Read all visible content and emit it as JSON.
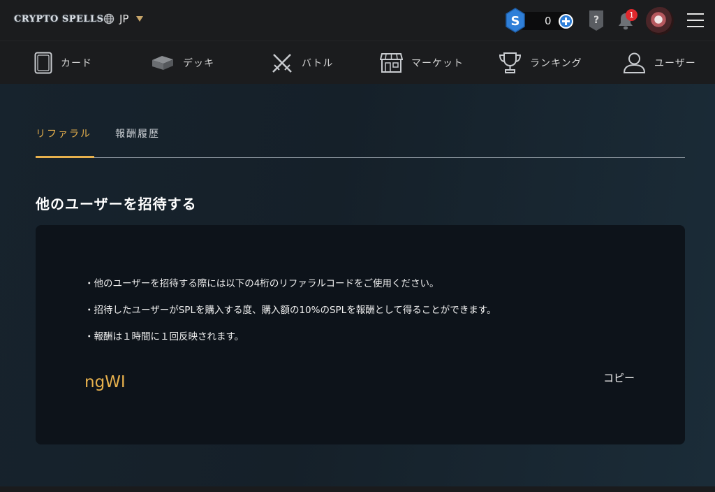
{
  "header": {
    "logo_text": "CRYPTO SPELLS",
    "language": "JP",
    "wallet_balance": "0",
    "notification_count": "1",
    "icons": [
      "globe-icon",
      "caret-down-icon",
      "spl-coin-icon",
      "add-funds-icon",
      "help-icon",
      "bell-icon",
      "avatar",
      "hamburger-menu-icon"
    ]
  },
  "nav": {
    "items": [
      {
        "label": "カード",
        "icon": "card-icon"
      },
      {
        "label": "デッキ",
        "icon": "deck-icon"
      },
      {
        "label": "バトル",
        "icon": "crossed-swords-icon"
      },
      {
        "label": "マーケット",
        "icon": "storefront-icon"
      },
      {
        "label": "ランキング",
        "icon": "trophy-icon"
      },
      {
        "label": "ユーザー",
        "icon": "user-icon"
      }
    ]
  },
  "tabs": {
    "active": "リファラル",
    "inactive": "報酬履歴"
  },
  "main": {
    "title": "他のユーザーを招待する",
    "info_lines": [
      "・他のユーザーを招待する際には以下の4桁のリファラルコードをご使用ください。",
      "・招待したユーザーがSPLを購入する度、購入額の10%のSPLを報酬として得ることができます。",
      "・報酬は１時間に１回反映されます。"
    ],
    "referral_code": "ngWI",
    "copy_label": "コピー"
  },
  "colors": {
    "accent": "#e6b04d",
    "header_bg": "#1b1c1e",
    "card_bg": "#0d131a",
    "badge_red": "#e0282d",
    "coin_blue": "#2f7fd8"
  }
}
